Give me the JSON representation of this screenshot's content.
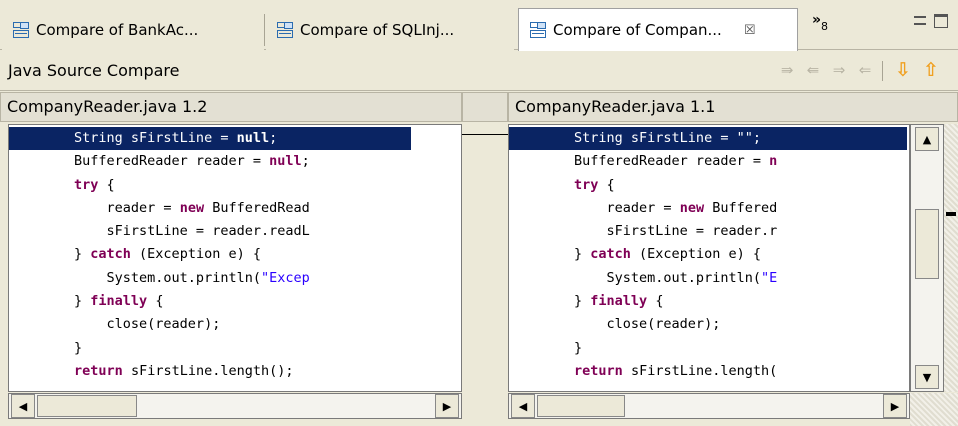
{
  "tabs": [
    {
      "label": "Compare of BankAc...",
      "active": false
    },
    {
      "label": "Compare of SQLInj...",
      "active": false
    },
    {
      "label": "Compare of Compan...",
      "active": true
    }
  ],
  "tab_close_glyph": "☒",
  "overflow": {
    "glyph": "»",
    "count": "8"
  },
  "compare_title": "Java Source Compare",
  "toolbar_icons": [
    "copy-all-right-icon",
    "copy-all-left-icon",
    "copy-right-icon",
    "copy-left-icon",
    "next-diff-icon",
    "prev-diff-icon"
  ],
  "left_pane": {
    "header": "CompanyReader.java 1.2",
    "lines": [
      [
        [
          "t",
          "        String sFirstLine = "
        ],
        [
          "k",
          "null"
        ],
        [
          "t",
          ";"
        ]
      ],
      [
        [
          "t",
          "        BufferedReader reader = "
        ],
        [
          "k",
          "null"
        ],
        [
          "t",
          ";"
        ]
      ],
      [
        [
          "t",
          "        "
        ],
        [
          "k",
          "try"
        ],
        [
          "t",
          " {"
        ]
      ],
      [
        [
          "t",
          "            reader = "
        ],
        [
          "k",
          "new"
        ],
        [
          "t",
          " BufferedRead"
        ]
      ],
      [
        [
          "t",
          "            sFirstLine = reader.readL"
        ]
      ],
      [
        [
          "t",
          "        } "
        ],
        [
          "k",
          "catch"
        ],
        [
          "t",
          " (Exception e) {"
        ]
      ],
      [
        [
          "t",
          "            System.out.println("
        ],
        [
          "s",
          "\"Excep"
        ]
      ],
      [
        [
          "t",
          "        } "
        ],
        [
          "k",
          "finally"
        ],
        [
          "t",
          " {"
        ]
      ],
      [
        [
          "t",
          "            close(reader);"
        ]
      ],
      [
        [
          "t",
          "        }"
        ]
      ],
      [
        [
          "t",
          "        "
        ],
        [
          "k",
          "return"
        ],
        [
          "t",
          " sFirstLine.length();"
        ]
      ]
    ]
  },
  "right_pane": {
    "header": "CompanyReader.java 1.1",
    "lines": [
      [
        [
          "t",
          "        String sFirstLine = "
        ],
        [
          "s",
          "\"\""
        ],
        [
          "t",
          ";"
        ]
      ],
      [
        [
          "t",
          "        BufferedReader reader = "
        ],
        [
          "k",
          "n"
        ]
      ],
      [
        [
          "t",
          "        "
        ],
        [
          "k",
          "try"
        ],
        [
          "t",
          " {"
        ]
      ],
      [
        [
          "t",
          "            reader = "
        ],
        [
          "k",
          "new"
        ],
        [
          "t",
          " Buffered"
        ]
      ],
      [
        [
          "t",
          "            sFirstLine = reader.r"
        ]
      ],
      [
        [
          "t",
          "        } "
        ],
        [
          "k",
          "catch"
        ],
        [
          "t",
          " (Exception e) {"
        ]
      ],
      [
        [
          "t",
          "            System.out.println("
        ],
        [
          "s",
          "\"E"
        ]
      ],
      [
        [
          "t",
          "        } "
        ],
        [
          "k",
          "finally"
        ],
        [
          "t",
          " {"
        ]
      ],
      [
        [
          "t",
          "            close(reader);"
        ]
      ],
      [
        [
          "t",
          "        }"
        ]
      ],
      [
        [
          "t",
          "        "
        ],
        [
          "k",
          "return"
        ],
        [
          "t",
          " sFirstLine.length("
        ]
      ]
    ]
  },
  "changed_line_index": 0,
  "colors": {
    "changed_bg": "#0a2463",
    "keyword": "#7f0055",
    "string": "#2a00ff"
  }
}
